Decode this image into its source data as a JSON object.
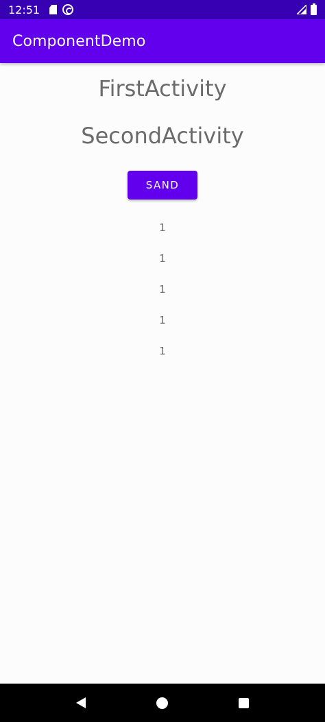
{
  "status_bar": {
    "time": "12:51",
    "icons": [
      "sd-card-icon",
      "notification-icon",
      "signal-icon",
      "battery-icon"
    ]
  },
  "app_bar": {
    "title": "ComponentDemo"
  },
  "main": {
    "first_activity_label": "FirstActivity",
    "second_activity_label": "SecondActivity",
    "sand_button_label": "SAND",
    "list_items": [
      "1",
      "1",
      "1",
      "1",
      "1"
    ]
  },
  "nav_bar": {
    "icons": [
      "back-icon",
      "home-icon",
      "recents-icon"
    ]
  },
  "colors": {
    "status_bar": "#3700b3",
    "app_bar": "#6200ee",
    "button": "#6200ee",
    "text_gray": "#6b6b6b",
    "background": "#fcfcfc"
  }
}
